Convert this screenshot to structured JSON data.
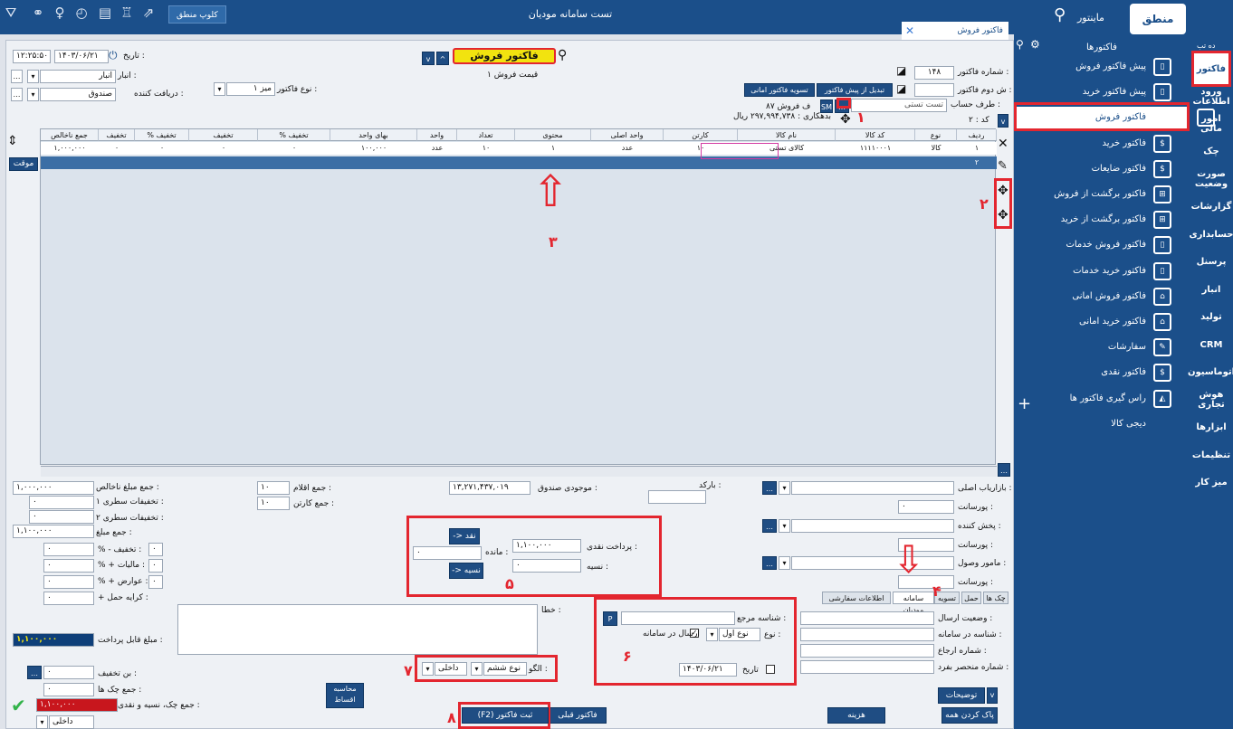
{
  "app": {
    "title": "تست سامانه مودیان",
    "club_label": "کلوپ منطق",
    "user_label": "ماینتور",
    "doc_tab": "فاکتور فروش"
  },
  "sidebar": {
    "header": "فاکتورها",
    "tree_label": "ده تب",
    "items": [
      "پیش فاکتور فروش",
      "پیش فاکتور خرید",
      "فاکتور فروش",
      "فاکتور خرید",
      "فاکتور ضایعات",
      "فاکتور برگشت از فروش",
      "فاکتور برگشت از خرید",
      "فاکتور فروش خدمات",
      "فاکتور خرید خدمات",
      "فاکتور فروش امانی",
      "فاکتور خرید امانی",
      "سفارشات",
      "فاکتور نقدی",
      "راس گیری فاکتور ها",
      "دیجی کالا"
    ],
    "vtabs": [
      "فاکتور",
      "ورود اطلاعات",
      "امور مالی",
      "چک",
      "صورت وضعیت",
      "گزارشات",
      "حسابداری",
      "پرسنل",
      "انبار",
      "تولید",
      "CRM",
      "اتوماسیون",
      "هوش تجاری",
      "ابزارها",
      "تنظیمات",
      "میز کار"
    ]
  },
  "header": {
    "date_label": "تاریخ :",
    "date_value": "۱۴۰۳/۰۶/۲۱",
    "time_value": "۱۲:۲۵:۵۰",
    "store_label": "انبار :",
    "store_value": "انبار",
    "receiver_label": "دریافت کننده :",
    "receiver_value": "صندوق",
    "invoice_type_label": "نوع فاکتور :",
    "invoice_type_value": "میز ۱",
    "invoice_title": "فاکتور فروش",
    "price_list": "قیمت فروش ۱",
    "invoice_no_label": "شماره فاکتور :",
    "invoice_no_value": "۱۴۸",
    "second_no_label": "ش دوم فاکتور :",
    "convert_btn": "تبدیل از پیش فاکتور",
    "settle_btn": "تسویه فاکتور امانی",
    "party_label": "طرف حساب :",
    "party_value": "تست تستی",
    "sm": "SM",
    "sales_label": "۸۷ ف فروش",
    "debt_label": "بدهکاری : ۲۹۷,۹۹۴,۷۳۸ ریال",
    "code_label": "کد : ۲",
    "temp_btn": "موقت",
    "arrows": "v"
  },
  "table": {
    "columns": [
      "ردیف",
      "نوع",
      "کد کالا",
      "نام کالا",
      "کارتن",
      "واحد اصلی",
      "محتوی",
      "تعداد",
      "واحد",
      "بهای واحد",
      "% تخفیف",
      "تخفیف",
      "% تخفیف",
      "تخفیف",
      "جمع ناخالص"
    ],
    "rows": [
      [
        "۱",
        "کالا",
        "۱۱۱۱۰۰۰۱",
        "کالای تستی",
        "۱۰",
        "عدد",
        "۱",
        "۱۰",
        "عدد",
        "۱۰۰,۰۰۰",
        "۰",
        "۰",
        "۰",
        "۰",
        "۱,۰۰۰,۰۰۰"
      ],
      [
        "۲",
        "",
        "",
        "",
        "",
        "",
        "",
        "",
        "",
        "",
        "",
        "",
        "",
        "",
        ""
      ]
    ]
  },
  "footer": {
    "gross_label": "جمع مبلغ ناخالص :",
    "gross": "۱,۰۰۰,۰۰۰",
    "line_disc1_label": "تخفیفات سطری ۱ :",
    "line_disc1": "۰",
    "line_disc2_label": "تخفیفات سطری ۲ :",
    "line_disc2": "۰",
    "total_label": "جمع مبلغ :",
    "total": "۱,۱۰۰,۰۰۰",
    "disc_label": "% - تخفیف :",
    "tax_label": "% + مالیات :",
    "duty_label": "% + عوارض :",
    "shipping_label": "+ کرایه حمل :",
    "payable_label": "مبلغ قابل پرداخت :",
    "payable": "۱,۱۰۰,۰۰۰",
    "coupon_label": "بن تخفیف :",
    "cheque_sum_label": "جمع چک ها :",
    "all_sum_label": "جمع چک، نسیه و نقدی :",
    "all_sum": "۱,۱۰۰,۰۰۰",
    "zero": "۰",
    "inner": "داخلی",
    "items_count_label": "جمع اقلام :",
    "items_count": "۱۰",
    "cartons_label": "جمع کارتن :",
    "cartons": "۱۰",
    "cashbox_label": "موجودی صندوق :",
    "cashbox": "۱۳,۲۷۱,۴۳۷,۰۱۹",
    "barcode_label": "بارکد :",
    "cash_label": "پرداخت نقدی :",
    "cash": "۱,۱۰۰,۰۰۰",
    "credit_label": "نسیه :",
    "credit": "۰",
    "remain_label": "مانده :",
    "remain": "۰",
    "to_cash": "-> نقد",
    "to_credit": "-> نسیه",
    "marketer_label": "بازاریاب اصلی :",
    "commission_label": "پورسانت :",
    "distributor_label": "پخش کننده :",
    "collector_label": "مامور وصول :",
    "tabs": [
      "چک ها",
      "حمل",
      "تسویه",
      "سامانه مودیان",
      "اطلاعات سفارشی"
    ],
    "error_label": "خطا :",
    "pattern_label": "الگو :",
    "pattern_value": "نوع ششم",
    "pattern_inner": "داخلی",
    "ref_label": "شناسه مرجع :",
    "type_label": "نوع :",
    "type_value": "نوع اول",
    "send_label": "ارسال در سامانه",
    "date2_label": "تاریخ",
    "date2": "۱۴۰۳/۰۶/۲۱",
    "send_status_label": "وضعیت ارسال :",
    "sys_id_label": "شناسه در سامانه :",
    "return_no_label": "شماره ارجاع :",
    "unique_label": "شماره منحصر بفرد :",
    "p": "P",
    "installments_btn": "محاسبه اقساط",
    "prev_btn": "فاکتور قبلی",
    "save_btn": "(F2) ثبت فاکتور",
    "cost_btn": "هزینه",
    "clear_btn": "پاک کردن همه",
    "desc_btn": "توضیحات"
  },
  "marks": [
    "۱",
    "۲",
    "۳",
    "۴",
    "۵",
    "۶",
    "۷",
    "۸"
  ]
}
